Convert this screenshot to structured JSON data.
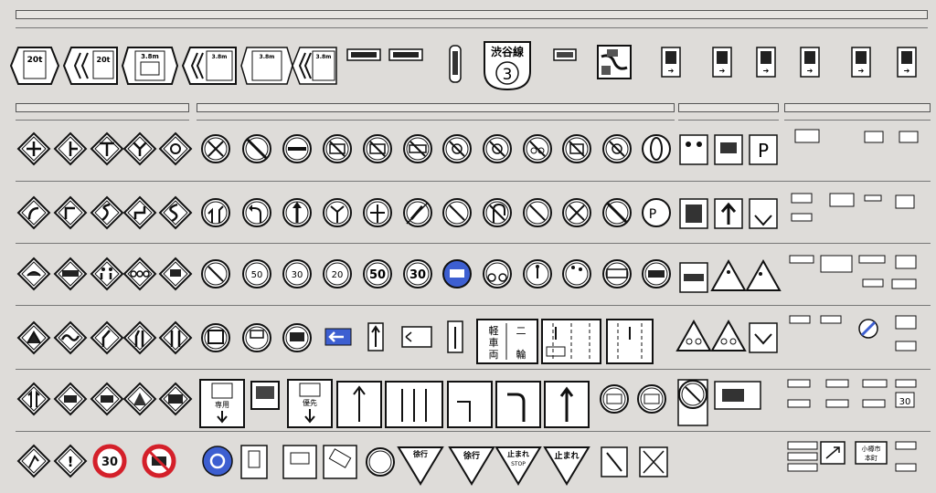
{
  "top_signs": {
    "weight_a": "20t",
    "weight_b": "20t",
    "height_a": "3.8m",
    "height_b": "3.8m",
    "height_c": "3.8m",
    "height_d": "3.8m",
    "route_name": "渋谷線",
    "route_number": "3"
  },
  "row3": {
    "speed_a": "50",
    "speed_b": "30",
    "speed_c": "20",
    "speed_d": "50",
    "speed_e": "30"
  },
  "row4": {
    "lane_chars": [
      "軽",
      "車",
      "両",
      "二",
      "輪"
    ]
  },
  "row5": {
    "lane_a": "専用",
    "lane_b": "優先"
  },
  "row6": {
    "speed_red": "30",
    "warn_a": "徐行",
    "warn_b": "徐行",
    "stop_a": "止まれ",
    "stop_b": "STOP",
    "stop_c": "止まれ"
  },
  "right_col": {
    "city": "小樽市",
    "town": "本町",
    "speed_box": "30"
  },
  "colors": {
    "blue_sign": "#3d5fd1",
    "red_ring": "#d4202a",
    "background": "#dedcd9"
  }
}
